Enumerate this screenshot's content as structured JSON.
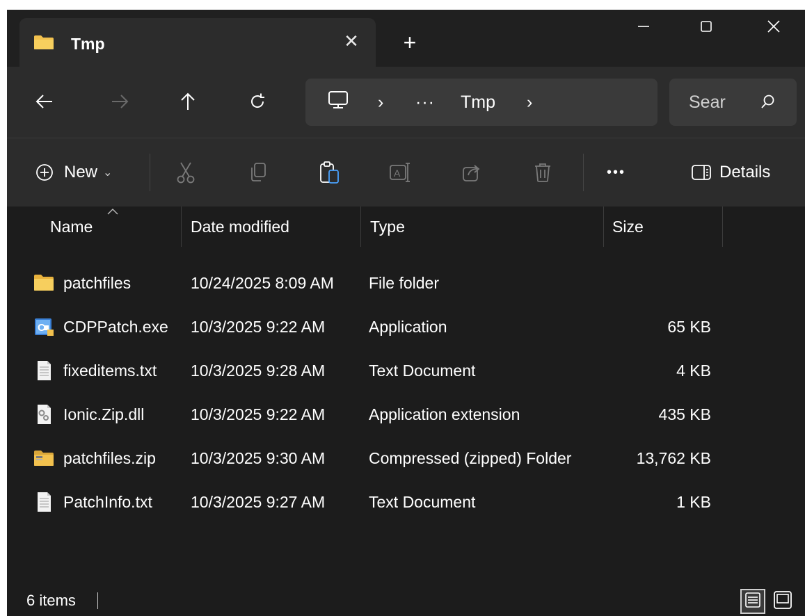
{
  "tab": {
    "title": "Tmp",
    "icon": "folder-icon",
    "close_glyph": "✕",
    "new_tab_glyph": "+"
  },
  "window_controls": {
    "minimize_icon": "minimize-icon",
    "maximize_icon": "maximize-icon",
    "close_icon": "close-icon"
  },
  "navigation": {
    "back_icon": "arrow-left-icon",
    "forward_icon": "arrow-right-icon",
    "up_icon": "arrow-up-icon",
    "refresh_icon": "refresh-icon"
  },
  "breadcrumb": {
    "root_icon": "monitor-icon",
    "separator": "›",
    "overflow": "···",
    "current": "Tmp"
  },
  "search": {
    "value": "Sear",
    "icon": "search-icon"
  },
  "commandbar": {
    "new_label": "New",
    "new_chevron": "⌄",
    "cut_icon": "cut-icon",
    "copy_icon": "copy-icon",
    "paste_icon": "paste-icon",
    "rename_icon": "rename-icon",
    "share_icon": "share-icon",
    "delete_icon": "delete-icon",
    "more_label": "•••",
    "details_label": "Details"
  },
  "columns": {
    "name": "Name",
    "date": "Date modified",
    "type": "Type",
    "size": "Size"
  },
  "files": [
    {
      "name": "patchfiles",
      "date": "10/24/2025 8:09 AM",
      "type": "File folder",
      "size": "",
      "icon": "folder-icon"
    },
    {
      "name": "CDPPatch.exe",
      "date": "10/3/2025 9:22 AM",
      "type": "Application",
      "size": "65 KB",
      "icon": "application-icon"
    },
    {
      "name": "fixeditems.txt",
      "date": "10/3/2025 9:28 AM",
      "type": "Text Document",
      "size": "4 KB",
      "icon": "text-file-icon"
    },
    {
      "name": "Ionic.Zip.dll",
      "date": "10/3/2025 9:22 AM",
      "type": "Application extension",
      "size": "435 KB",
      "icon": "dll-file-icon"
    },
    {
      "name": "patchfiles.zip",
      "date": "10/3/2025 9:30 AM",
      "type": "Compressed (zipped) Folder",
      "size": "13,762 KB",
      "icon": "zip-folder-icon"
    },
    {
      "name": "PatchInfo.txt",
      "date": "10/3/2025 9:27 AM",
      "type": "Text Document",
      "size": "1 KB",
      "icon": "text-file-icon"
    }
  ],
  "status": {
    "item_count": "6 items"
  },
  "colors": {
    "background": "#1c1c1c",
    "toolbar": "#2c2c2c",
    "folder_yellow": "#f2c14e",
    "text": "#ffffff"
  }
}
